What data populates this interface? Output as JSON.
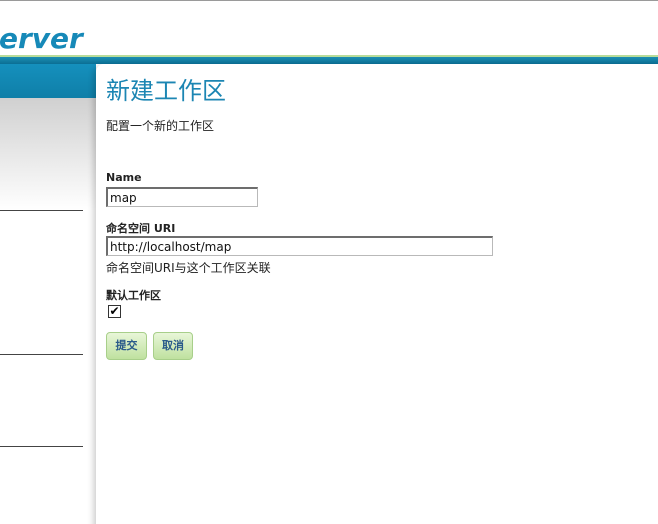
{
  "header": {
    "logo_text": "erver"
  },
  "page": {
    "title": "新建工作区",
    "description": "配置一个新的工作区"
  },
  "form": {
    "name": {
      "label": "Name",
      "value": "map"
    },
    "namespace_uri": {
      "label": "命名空间 URI",
      "value": "http://localhost/map",
      "help": "命名空间URI与这个工作区关联"
    },
    "default_workspace": {
      "label": "默认工作区",
      "checked": true,
      "check_glyph": "✔"
    }
  },
  "buttons": {
    "submit_label": "提交",
    "cancel_label": "取消"
  },
  "colors": {
    "accent": "#1c86b3",
    "header_strip": "#0b6f95",
    "button_green": "#bfe19f"
  }
}
